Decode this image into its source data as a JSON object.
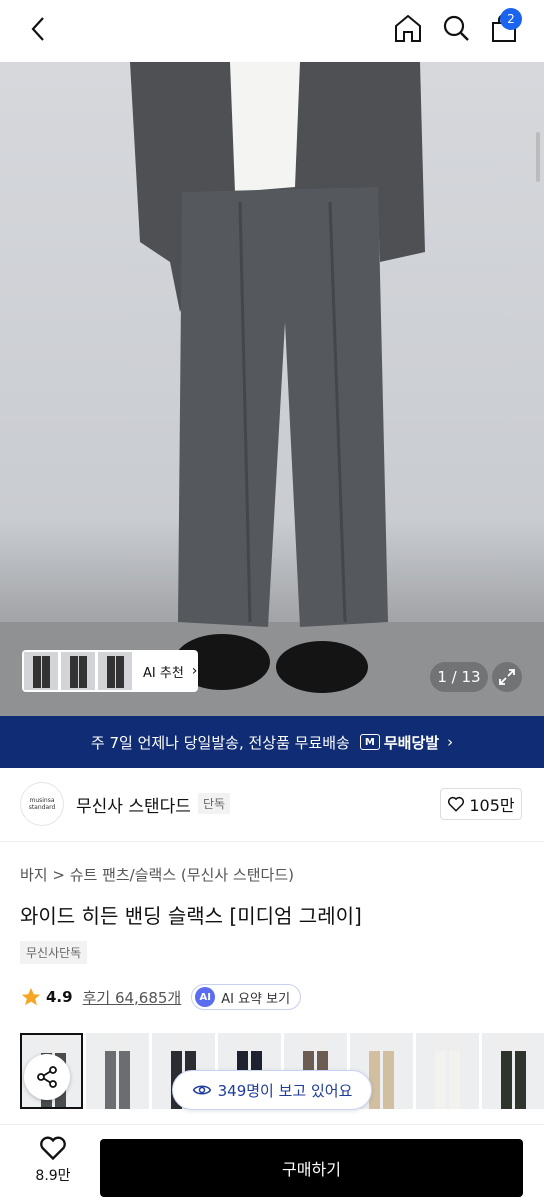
{
  "nav": {
    "cart_count": "2",
    "icons": [
      "back-icon",
      "home-icon",
      "search-icon",
      "shopping-bag-icon"
    ]
  },
  "hero": {
    "ai_recommend": "AI 추천",
    "image_counter": "1 / 13"
  },
  "banner": {
    "text": "주 7일 언제나 당일발송, 전상품 무료배송",
    "badge": "M",
    "free_label": "무배당발"
  },
  "brand": {
    "logo_line1": "musinsa",
    "logo_line2": "standard",
    "name": "무신사 스탠다드",
    "tag": "단독",
    "likes": "105만"
  },
  "product": {
    "breadcrumb": "바지 > 슈트 팬츠/슬랙스 (무신사 스탠다드)",
    "title": "와이드 히든 밴딩 슬랙스 [미디엄 그레이]",
    "exclusive_tag": "무신사단독",
    "rating": "4.9",
    "reviews": "후기 64,685개",
    "ai_badge": "AI",
    "ai_summary": "AI 요약 보기"
  },
  "swatches": [
    {
      "color": "#4a4c50",
      "selected": true
    },
    {
      "color": "#6b6d70"
    },
    {
      "color": "#2b2d33"
    },
    {
      "color": "#1e2230"
    },
    {
      "color": "#6c5d52"
    },
    {
      "color": "#d2bfa0"
    },
    {
      "color": "#f2f2ee"
    },
    {
      "color": "#2e352c"
    }
  ],
  "watching": "349명이 보고 있어요",
  "bottom": {
    "wish_count": "8.9만",
    "buy_label": "구매하기"
  },
  "colors": {
    "accent": "#1a64f0",
    "banner_bg": "#0f2c74",
    "buy_bg": "#000000"
  }
}
